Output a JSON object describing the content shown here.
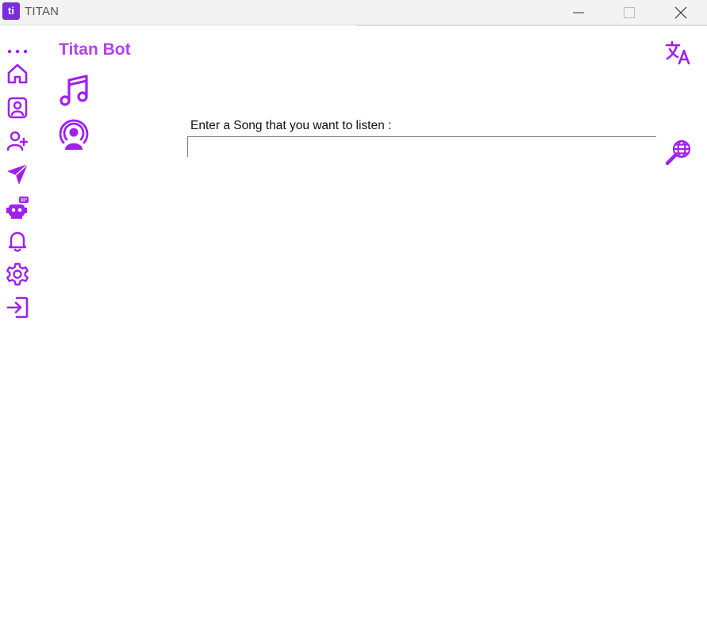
{
  "window": {
    "title": "TITAN",
    "logo_text": "ti",
    "controls": [
      "minimize",
      "maximize",
      "close"
    ]
  },
  "sidebar": {
    "items": [
      {
        "name": "more",
        "icon": "more-dots-icon"
      },
      {
        "name": "home",
        "icon": "home-icon"
      },
      {
        "name": "profile",
        "icon": "user-card-icon"
      },
      {
        "name": "add-user",
        "icon": "user-plus-icon"
      },
      {
        "name": "send",
        "icon": "send-icon"
      },
      {
        "name": "bot",
        "icon": "robot-icon"
      },
      {
        "name": "notifications",
        "icon": "bell-icon"
      },
      {
        "name": "settings",
        "icon": "gear-icon"
      },
      {
        "name": "sign-out",
        "icon": "sign-out-icon"
      }
    ]
  },
  "header": {
    "brand": "Titan Bot"
  },
  "features": [
    {
      "name": "music",
      "icon": "music-note-icon"
    },
    {
      "name": "podcast",
      "icon": "podcast-icon"
    }
  ],
  "main": {
    "prompt_label": "Enter a Song that you want to listen :",
    "song_input_value": "",
    "song_input_placeholder": ""
  },
  "tools": [
    {
      "name": "translate",
      "icon": "translate-icon"
    },
    {
      "name": "web-search",
      "icon": "globe-search-icon"
    }
  ],
  "colors": {
    "accent": "#a020f0",
    "brand_text": "#b042f0",
    "titlebar": "#f3f3f3",
    "logo_bg": "#7a2fd6"
  }
}
